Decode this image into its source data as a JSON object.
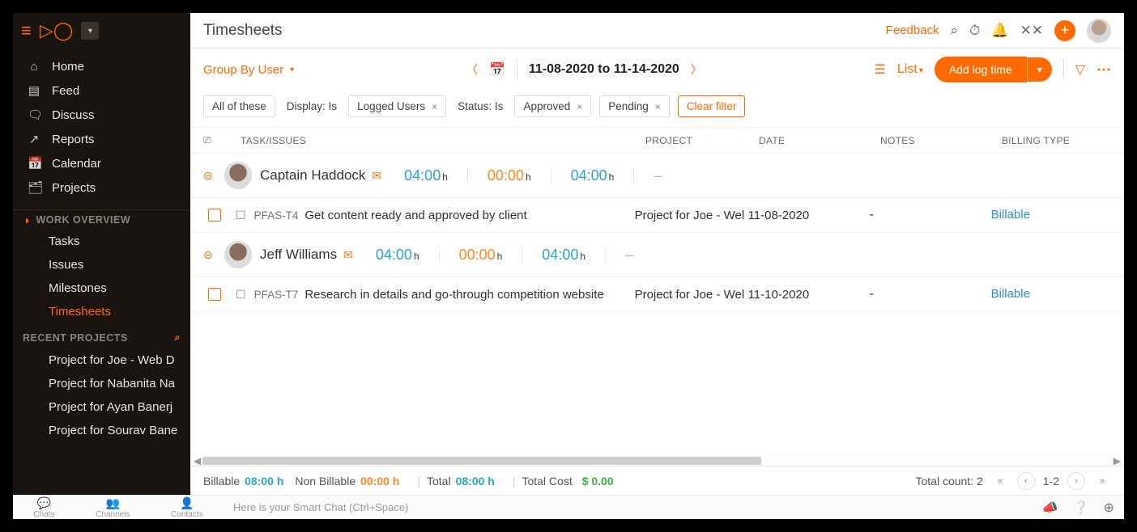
{
  "sidebar": {
    "menu": [
      {
        "icon": "⌂",
        "label": "Home"
      },
      {
        "icon": "▤",
        "label": "Feed"
      },
      {
        "icon": "🗨",
        "label": "Discuss"
      },
      {
        "icon": "↗",
        "label": "Reports"
      },
      {
        "icon": "📅",
        "label": "Calendar"
      },
      {
        "icon": "🗂",
        "label": "Projects"
      }
    ],
    "work_overview_title": "WORK OVERVIEW",
    "work_overview": [
      {
        "label": "Tasks"
      },
      {
        "label": "Issues"
      },
      {
        "label": "Milestones"
      },
      {
        "label": "Timesheets",
        "active": true
      }
    ],
    "recent_title": "RECENT PROJECTS",
    "recent": [
      "Project for Joe - Web D",
      "Project for Nabanita Na",
      "Project for Ayan Banerj",
      "Project for Sourav Bane"
    ]
  },
  "header": {
    "title": "Timesheets",
    "feedback": "Feedback"
  },
  "controls": {
    "group_by": "Group By User",
    "date_range": "11-08-2020 to 11-14-2020",
    "view": "List",
    "add_log": "Add log time"
  },
  "filters": {
    "all": "All of these",
    "display_label": "Display: Is",
    "display_val": "Logged Users",
    "status_label": "Status: Is",
    "status_vals": [
      "Approved",
      "Pending"
    ],
    "clear": "Clear filter"
  },
  "columns": {
    "task": "TASK/ISSUES",
    "project": "PROJECT",
    "date": "DATE",
    "notes": "NOTES",
    "billing": "BILLING TYPE"
  },
  "groups": [
    {
      "name": "Captain Haddock",
      "billable": "04:00",
      "nonbillable": "00:00",
      "total": "04:00",
      "extra": "–",
      "rows": [
        {
          "key": "PFAS-T4",
          "title": "Get content ready and approved by client",
          "project": "Project for Joe - Wel",
          "date": "11-08-2020",
          "notes": "-",
          "billing": "Billable"
        }
      ]
    },
    {
      "name": "Jeff Williams",
      "billable": "04:00",
      "nonbillable": "00:00",
      "total": "04:00",
      "extra": "–",
      "rows": [
        {
          "key": "PFAS-T7",
          "title": "Research in details and go-through competition website",
          "project": "Project for Joe - Wel",
          "date": "11-10-2020",
          "notes": "-",
          "billing": "Billable"
        }
      ]
    }
  ],
  "summary": {
    "billable_label": "Billable",
    "billable": "08:00 h",
    "nonbillable_label": "Non Billable",
    "nonbillable": "00:00 h",
    "total_label": "Total",
    "total": "08:00 h",
    "cost_label": "Total Cost",
    "cost": "$ 0.00",
    "count_label": "Total count: 2",
    "range": "1-2"
  },
  "bottombar": {
    "items": [
      "Chats",
      "Channels",
      "Contacts"
    ],
    "smart": "Here is your Smart Chat (Ctrl+Space)"
  }
}
